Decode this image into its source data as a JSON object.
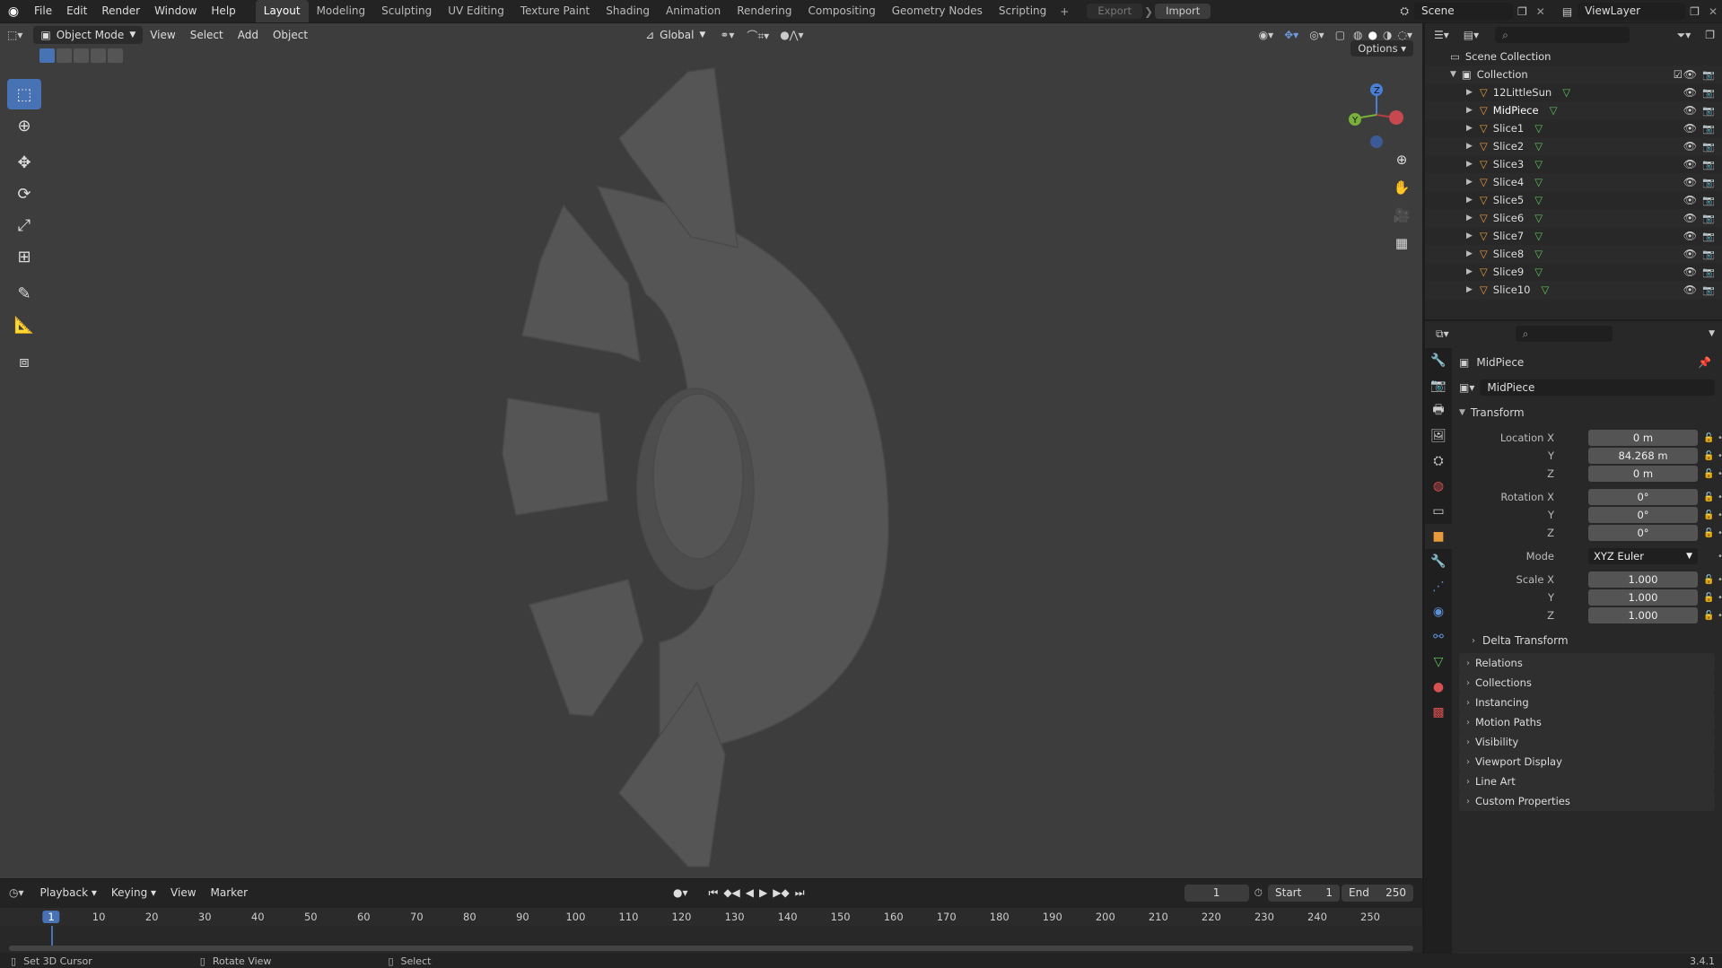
{
  "app": {
    "version": "3.4.1"
  },
  "topbar": {
    "menus": [
      "File",
      "Edit",
      "Render",
      "Window",
      "Help"
    ],
    "workspaces": [
      "Layout",
      "Modeling",
      "Sculpting",
      "UV Editing",
      "Texture Paint",
      "Shading",
      "Animation",
      "Rendering",
      "Compositing",
      "Geometry Nodes",
      "Scripting"
    ],
    "active_workspace": "Layout",
    "export_label": "Export",
    "import_label": "Import",
    "scene": "Scene",
    "view_layer": "ViewLayer"
  },
  "viewport": {
    "mode": "Object Mode",
    "menus": [
      "View",
      "Select",
      "Add",
      "Object"
    ],
    "transform_orientation": "Global",
    "options_label": "Options",
    "gizmo": {
      "z": "Z",
      "y": "Y"
    }
  },
  "outliner": {
    "root": "Scene Collection",
    "collection": "Collection",
    "objects": [
      "12LittleSun",
      "MidPiece",
      "Slice1",
      "Slice2",
      "Slice3",
      "Slice4",
      "Slice5",
      "Slice6",
      "Slice7",
      "Slice8",
      "Slice9",
      "Slice10"
    ],
    "selected": "MidPiece"
  },
  "properties": {
    "object_name": "MidPiece",
    "datablock_name": "MidPiece",
    "transform_label": "Transform",
    "location_label": "Location X",
    "rotation_label": "Rotation X",
    "scale_label": "Scale X",
    "mode_label": "Mode",
    "axis_y": "Y",
    "axis_z": "Z",
    "location": {
      "x": "0 m",
      "y": "84.268 m",
      "z": "0 m"
    },
    "rotation": {
      "x": "0°",
      "y": "0°",
      "z": "0°"
    },
    "rotation_mode": "XYZ Euler",
    "scale": {
      "x": "1.000",
      "y": "1.000",
      "z": "1.000"
    },
    "delta_transform": "Delta Transform",
    "panels": [
      "Relations",
      "Collections",
      "Instancing",
      "Motion Paths",
      "Visibility",
      "Viewport Display",
      "Line Art",
      "Custom Properties"
    ]
  },
  "timeline": {
    "menus": [
      "Playback",
      "Keying",
      "View",
      "Marker"
    ],
    "current_frame": "1",
    "start_label": "Start",
    "start": "1",
    "end_label": "End",
    "end": "250",
    "ticks": [
      "1",
      "10",
      "20",
      "30",
      "40",
      "50",
      "60",
      "70",
      "80",
      "90",
      "100",
      "110",
      "120",
      "130",
      "140",
      "150",
      "160",
      "170",
      "180",
      "190",
      "200",
      "210",
      "220",
      "230",
      "240",
      "250"
    ]
  },
  "statusbar": {
    "hint1": "Set 3D Cursor",
    "hint2": "Rotate View",
    "hint3": "Select"
  },
  "colors": {
    "accent": "#4772b3",
    "viewport_bg": "#3d3d3d",
    "mesh": "#545454",
    "selected_row": "#334d80"
  }
}
